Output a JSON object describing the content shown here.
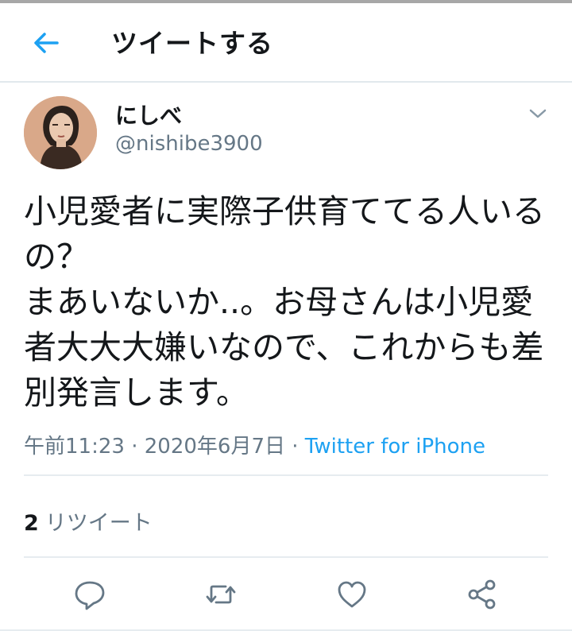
{
  "header": {
    "title": "ツイートする",
    "back_icon": "arrow-left-icon",
    "accent_color": "#1da1f2"
  },
  "tweet": {
    "display_name": "にしべ",
    "handle": "@nishibe3900",
    "text": "小児愛者に実際子供育ててる人いるの？\nまあいないか..。お母さんは小児愛者大大大嫌いなので、これからも差別発言します。",
    "time": "午前11:23",
    "date": "2020年6月7日",
    "separator": "·",
    "source": "Twitter for iPhone"
  },
  "stats": {
    "retweet_count": "2",
    "retweet_label": "リツイート"
  },
  "actions": [
    "reply-icon",
    "retweet-icon",
    "like-icon",
    "share-icon"
  ],
  "colors": {
    "text": "#14171a",
    "secondary": "#657786",
    "link": "#1da1f2",
    "divider": "#e6ecf0"
  }
}
